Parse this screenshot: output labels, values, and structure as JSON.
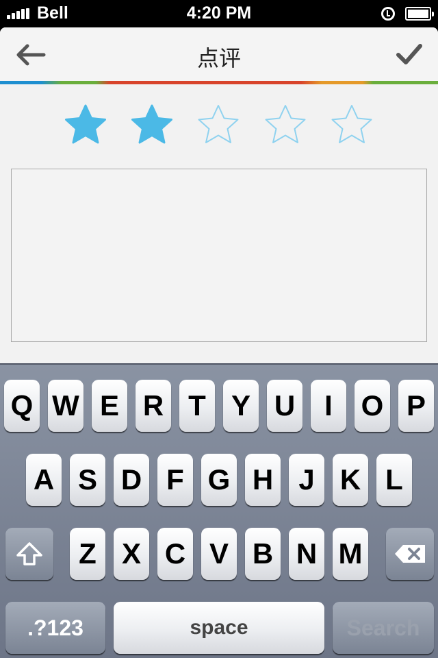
{
  "status_bar": {
    "carrier": "Bell",
    "time": "4:20 PM"
  },
  "nav": {
    "title": "点评",
    "back_icon": "arrow-left-icon",
    "confirm_icon": "checkmark-icon"
  },
  "rating": {
    "value": 2,
    "max": 5,
    "filled_color": "#4bb9e6",
    "empty_color": "#8fd2ef"
  },
  "review": {
    "value": "",
    "placeholder": ""
  },
  "keyboard": {
    "row1": [
      "Q",
      "W",
      "E",
      "R",
      "T",
      "Y",
      "U",
      "I",
      "O",
      "P"
    ],
    "row2": [
      "A",
      "S",
      "D",
      "F",
      "G",
      "H",
      "J",
      "K",
      "L"
    ],
    "row3": [
      "Z",
      "X",
      "C",
      "V",
      "B",
      "N",
      "M"
    ],
    "shift_icon": "shift-arrow-icon",
    "delete_icon": "backspace-icon",
    "numbers_label": ".?123",
    "space_label": "space",
    "search_label": "Search"
  },
  "colors": {
    "accent": "#4bb9e6",
    "rainbow": [
      "#1e8fd0",
      "#6aae3c",
      "#d8442b",
      "#e59a2a",
      "#6aae3c"
    ]
  }
}
